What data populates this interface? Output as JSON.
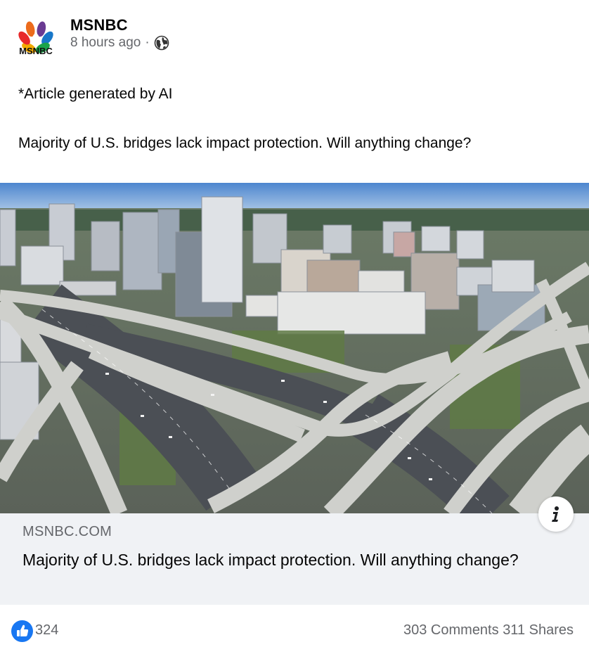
{
  "post": {
    "page_name": "MSNBC",
    "logo_text": "MSNBC",
    "time_ago": "8 hours ago",
    "separator": "·",
    "privacy_icon": "globe-icon",
    "text_line1": "*Article generated by AI",
    "text_line2": "Majority of U.S. bridges lack impact protection. Will anything change?"
  },
  "link_preview": {
    "domain": "MSNBC.COM",
    "title": "Majority of U.S. bridges lack impact protection. Will anything change?",
    "info_icon": "info-icon"
  },
  "reactions": {
    "like_count": "324",
    "comments_label": "303 Comments",
    "shares_label": "311 Shares"
  },
  "colors": {
    "secondary_text": "#65676b",
    "link_box_bg": "#f0f2f5",
    "like_blue": "#1877f2"
  }
}
